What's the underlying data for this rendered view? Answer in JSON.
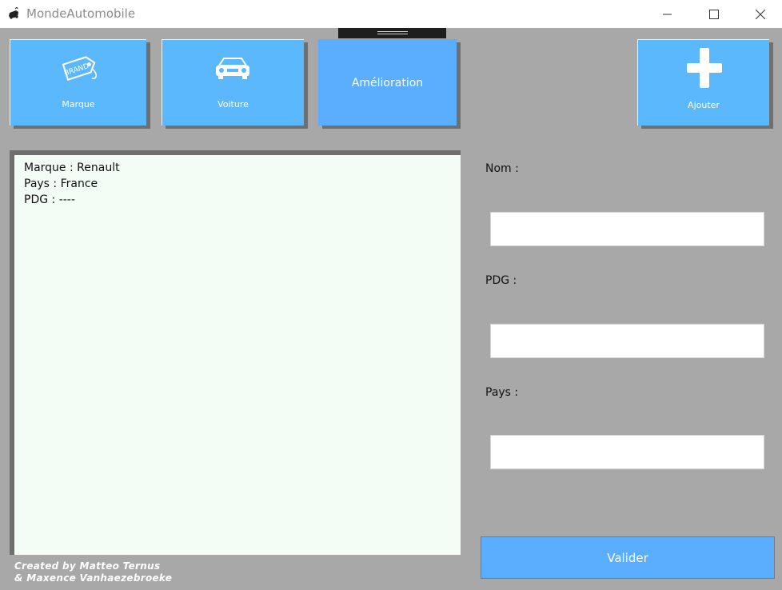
{
  "window": {
    "title": "MondeAutomobile",
    "icon": "car-app-icon"
  },
  "nav": {
    "marque_label": "Marque",
    "voiture_label": "Voiture",
    "amelioration_label": "Amélioration",
    "ajouter_label": "Ajouter"
  },
  "details": {
    "lines": [
      "Marque : Renault",
      "Pays : France",
      "PDG : ----"
    ]
  },
  "form": {
    "nom_label": "Nom :",
    "nom_value": "",
    "pdg_label": "PDG :",
    "pdg_value": "",
    "pays_label": "Pays :",
    "pays_value": "",
    "submit_label": "Valider"
  },
  "credits": {
    "line1": "Created by Matteo Ternus",
    "line2": "& Maxence Vanhaezebroeke"
  },
  "colors": {
    "tile": "#5cb8fd",
    "tile_active": "#5baefe",
    "background": "#a8a8a8",
    "panel": "#f3fdf6"
  }
}
